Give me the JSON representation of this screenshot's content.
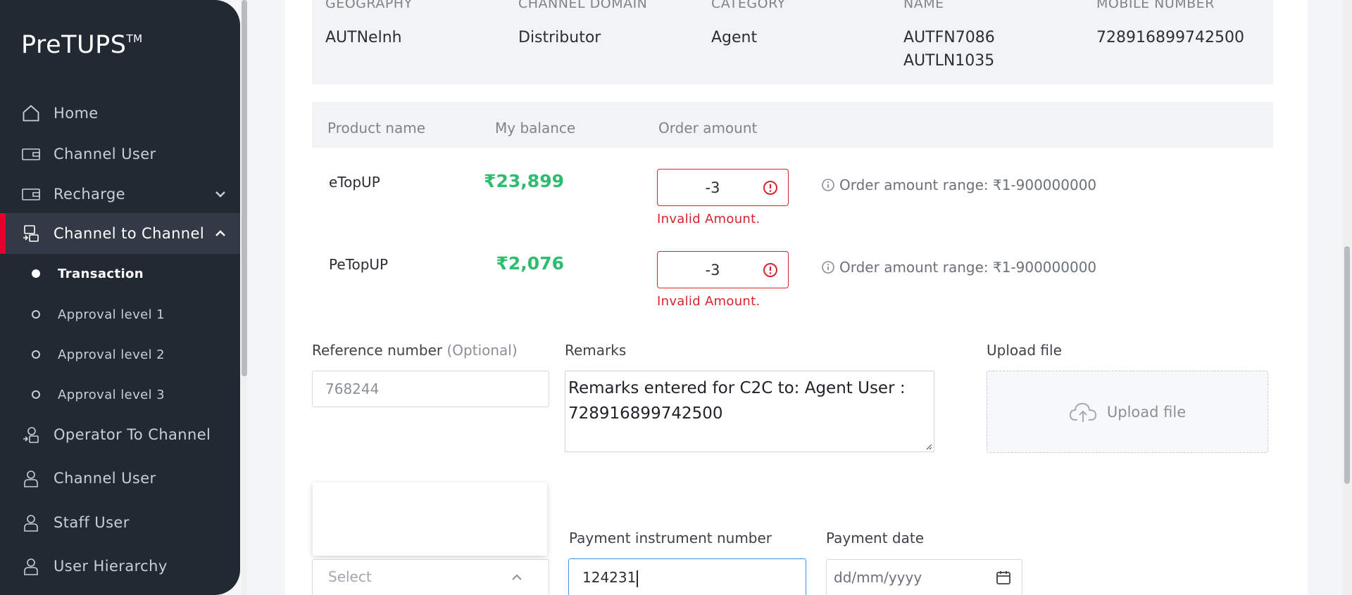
{
  "sidebar": {
    "logo_text": "PreTUPS",
    "logo_tm": "TM",
    "items": [
      {
        "label": "Home",
        "icon": "home-icon"
      },
      {
        "label": "Channel User",
        "icon": "wallet-icon"
      },
      {
        "label": "Recharge",
        "icon": "wallet-icon"
      },
      {
        "label": "Channel to Channel",
        "icon": "transfer-icon"
      },
      {
        "label": "Operator To Channel",
        "icon": "transfer-icon"
      },
      {
        "label": "Channel User",
        "icon": "user-icon"
      },
      {
        "label": "Staff User",
        "icon": "user-icon"
      },
      {
        "label": "User Hierarchy",
        "icon": "user-icon"
      }
    ],
    "sub_items": [
      {
        "label": "Transaction"
      },
      {
        "label": "Approval level 1"
      },
      {
        "label": "Approval level 2"
      },
      {
        "label": "Approval level 3"
      }
    ]
  },
  "user_details": {
    "geography_label": "GEOGRAPHY",
    "geography_value": "AUTNelnh",
    "domain_label": "CHANNEL DOMAIN",
    "domain_value": "Distributor",
    "category_label": "CATEGORY",
    "category_value": "Agent",
    "name_label": "NAME",
    "name_line1": "AUTFN7086",
    "name_line2": "AUTLN1035",
    "mobile_label": "MOBILE NUMBER",
    "mobile_value": "728916899742500"
  },
  "products": {
    "headers": {
      "name": "Product name",
      "balance": "My balance",
      "amount": "Order amount"
    },
    "rows": [
      {
        "name": "eTopUP",
        "balance": "₹23,899",
        "amount": "-3",
        "error": "Invalid Amount.",
        "range": "Order amount range: ₹1-900000000"
      },
      {
        "name": "PeTopUP",
        "balance": "₹2,076",
        "amount": "-3",
        "error": "Invalid Amount.",
        "range": "Order amount range: ₹1-900000000"
      }
    ]
  },
  "form": {
    "reference_label": "Reference number",
    "reference_optional": "(Optional)",
    "reference_value": "768244",
    "remarks_label": "Remarks",
    "remarks_value": "Remarks entered for C2C to: Agent User : 728916899742500",
    "upload_label": "Upload file",
    "upload_button": "Upload file",
    "payment_type_placeholder": "Select",
    "payment_instrument_label": "Payment instrument number",
    "payment_instrument_value": "124231",
    "payment_date_label": "Payment date",
    "payment_date_placeholder": "dd/mm/yyyy"
  },
  "colors": {
    "sidebar_bg": "#212a33",
    "active_accent": "#e4002b",
    "balance_green": "#2dbd6e",
    "error_red": "#d9242e",
    "focus_blue": "#4a90d9"
  }
}
